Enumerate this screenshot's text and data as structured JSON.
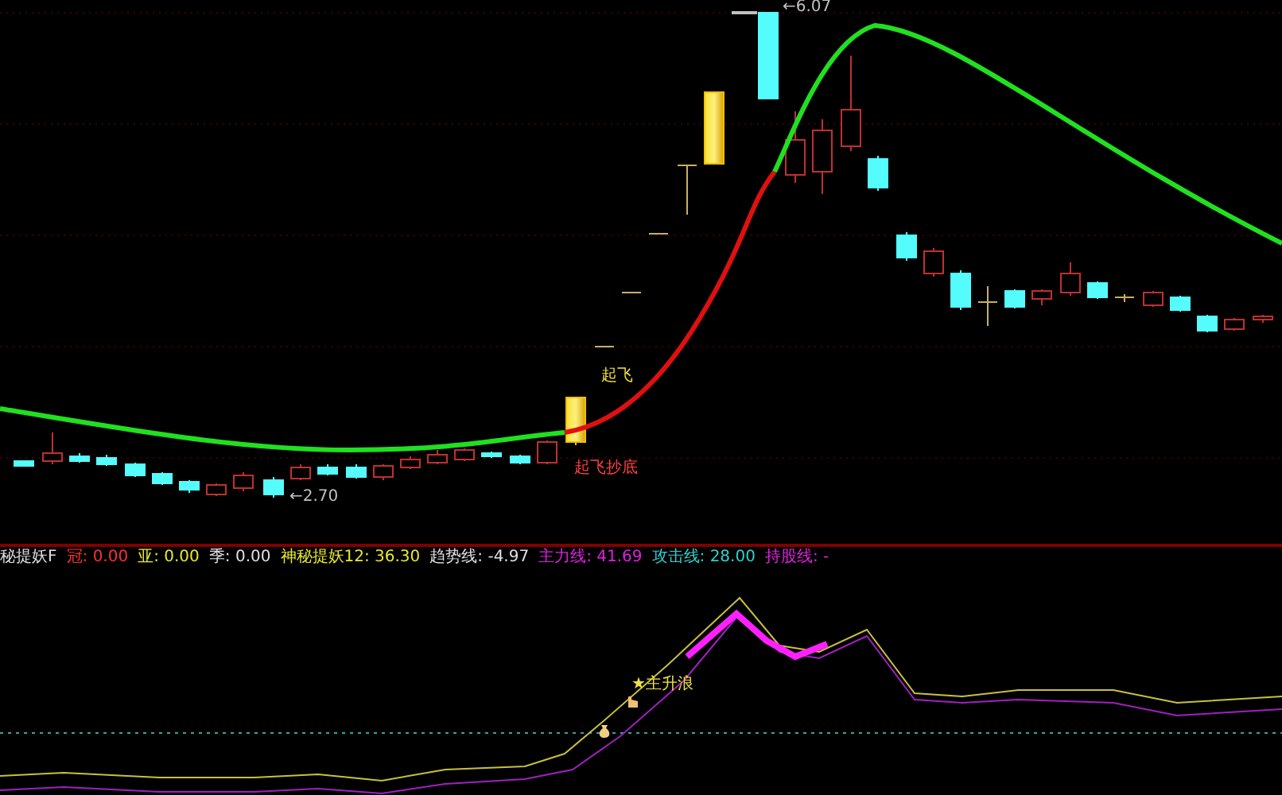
{
  "main_chart": {
    "annotations": [
      {
        "kind": "high",
        "text": "←6.07"
      },
      {
        "kind": "low",
        "text": "←2.70"
      },
      {
        "kind": "signal",
        "text": "起飞"
      },
      {
        "kind": "bottom",
        "text": "起飞抄底"
      }
    ]
  },
  "indicator": {
    "legend": [
      {
        "text": "秘提妖F",
        "color": "#e0e0e0"
      },
      {
        "text": "冠: 0.00",
        "color": "#ff3030"
      },
      {
        "text": "亚: 0.00",
        "color": "#e8e830"
      },
      {
        "text": "季: 0.00",
        "color": "#e0e0e0"
      },
      {
        "text": "神秘提妖12: 36.30",
        "color": "#e8e830"
      },
      {
        "text": "趋势线: -4.97",
        "color": "#e0e0e0"
      },
      {
        "text": "主力线: 41.69",
        "color": "#e020e0"
      },
      {
        "text": "攻击线: 28.00",
        "color": "#30d0d0"
      },
      {
        "text": "持股线: -",
        "color": "#e020e0"
      }
    ],
    "signal": "★主升浪"
  }
}
